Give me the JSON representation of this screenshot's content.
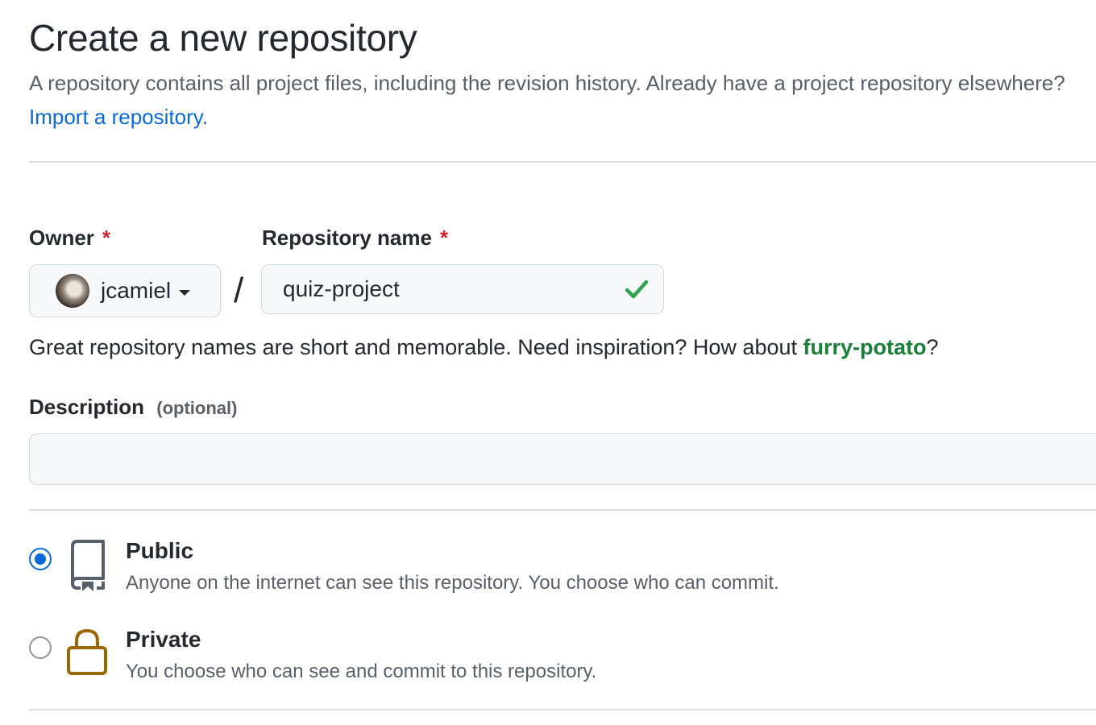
{
  "header": {
    "title": "Create a new repository",
    "subtitle_text": "A repository contains all project files, including the revision history. Already have a project repository elsewhere?",
    "import_link": "Import a repository."
  },
  "owner": {
    "label": "Owner",
    "required_mark": "*",
    "selected": "jcamiel",
    "icon": "chevron-down-icon"
  },
  "separator": "/",
  "repository_name": {
    "label": "Repository name",
    "required_mark": "*",
    "value": "quiz-project",
    "status_icon": "check-icon",
    "status_color": "#2da44e"
  },
  "name_hint": {
    "text_before": "Great repository names are short and memorable. Need inspiration? How about",
    "suggestion": "furry-potato",
    "text_after": "?"
  },
  "description": {
    "label": "Description",
    "optional_label": "(optional)",
    "value": ""
  },
  "visibility": {
    "options": [
      {
        "title": "Public",
        "description": "Anyone on the internet can see this repository. You choose who can commit.",
        "icon": "repo-icon",
        "selected": true
      },
      {
        "title": "Private",
        "description": "You choose who can see and commit to this repository.",
        "icon": "lock-icon",
        "selected": false
      }
    ]
  },
  "colors": {
    "link": "#0969da",
    "suggestion": "#1a7f37",
    "required": "#cf222e",
    "lock": "#9a6700"
  }
}
